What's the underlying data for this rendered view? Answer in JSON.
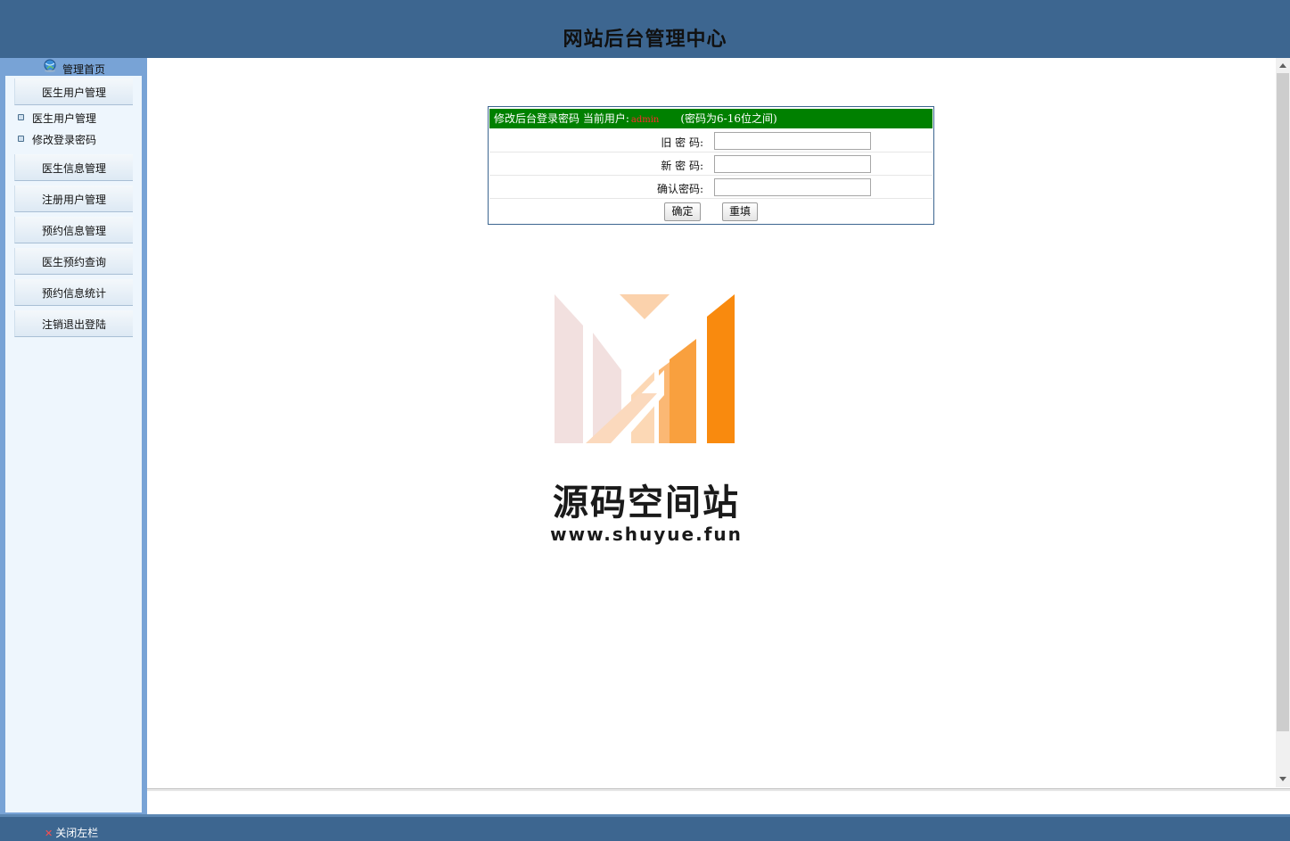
{
  "header": {
    "title": "网站后台管理中心"
  },
  "sidebar": {
    "home_label": "管理首页",
    "groups": [
      {
        "label": "医生用户管理"
      },
      {
        "label": "医生信息管理"
      },
      {
        "label": "注册用户管理"
      },
      {
        "label": "预约信息管理"
      },
      {
        "label": "医生预约查询"
      },
      {
        "label": "预约信息统计"
      },
      {
        "label": "注销退出登陆"
      }
    ],
    "sub_items": [
      {
        "label": "医生用户管理"
      },
      {
        "label": "修改登录密码"
      }
    ]
  },
  "form": {
    "heading": "修改后台登录密码 当前用户:",
    "current_user": "admin",
    "hint": "(密码为6-16位之间)",
    "old_password_label": "旧 密 码:",
    "new_password_label": "新 密 码:",
    "confirm_password_label": "确认密码:",
    "old_password_value": "",
    "new_password_value": "",
    "confirm_password_value": "",
    "submit_label": "确定",
    "reset_label": "重填"
  },
  "logo": {
    "name": "源码空间站",
    "url": "www.shuyue.fun"
  },
  "footer": {
    "close_sidebar_label": "关闭左栏"
  },
  "colors": {
    "header_bg": "#3d6690",
    "sidebar_bg": "#78a3d6",
    "form_head_bg": "#008000",
    "current_user": "#ff2a2a",
    "logo_orange": "#f98a0e"
  }
}
